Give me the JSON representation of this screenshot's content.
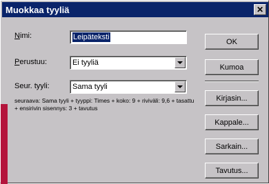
{
  "dialog": {
    "title": "Muokkaa tyyliä",
    "close_glyph": "✕"
  },
  "form": {
    "name_label": "Nimi:",
    "name_value": "Leipäteksti",
    "based_on_label": "Perustuu:",
    "based_on_value": "Ei tyyliä",
    "next_style_label": "Seur. tyyli:",
    "next_style_value": "Sama tyyli"
  },
  "description": "seuraava: Sama tyyli + tyyppi: Times + koko: 9 + riviväli: 9,6 + tasattu + ensirivin sisennys: 3 + tavutus",
  "buttons": {
    "ok": "OK",
    "cancel": "Kumoa",
    "font": "Kirjasin...",
    "paragraph": "Kappale...",
    "tabs": "Sarkain...",
    "hyphenation": "Tavutus..."
  },
  "colors": {
    "face": "#c6c3c6",
    "titlebar": "#0a246a",
    "accent_strip": "#b4143c"
  }
}
